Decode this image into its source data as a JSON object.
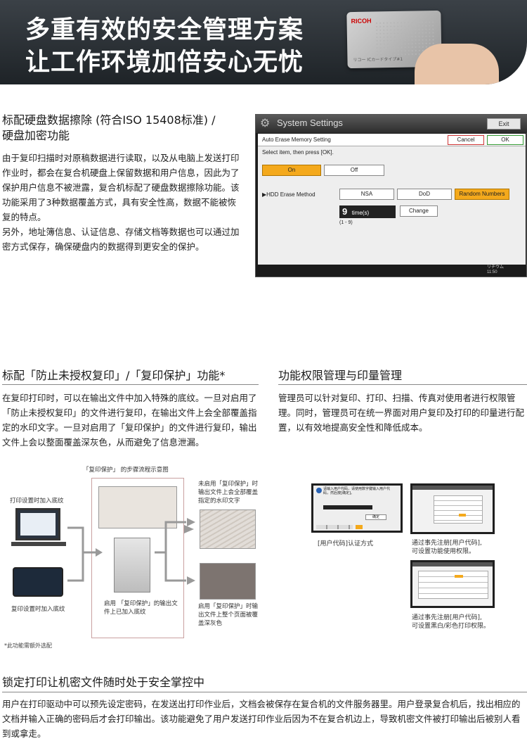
{
  "banner": {
    "line1": "多重有效的安全管理方案",
    "line2": "让工作环境加倍安心无忧",
    "card_brand": "RICOH",
    "card_text": "リコー ICカードタイプ#1"
  },
  "section1": {
    "title_line1": "标配硬盘数据擦除 (符合ISO 15408标准) /",
    "title_line2": "硬盘加密功能",
    "para1": "由于复印扫描时对原稿数据进行读取，以及从电脑上发送打印作业时，都会在复合机硬盘上保留数据和用户信息，因此为了保护用户信息不被泄露，复合机标配了硬盘数据擦除功能。该功能采用了3种数据覆盖方式，具有安全性高，数据不能被恢复的特点。",
    "para2": "另外，地址簿信息、认证信息、存储文档等数据也可以通过加密方式保存，确保硬盘内的数据得到更安全的保护。"
  },
  "panel": {
    "title": "System Settings",
    "exit": "Exit",
    "menu": "Auto Erase Memory Setting",
    "cancel": "Cancel",
    "ok": "OK",
    "instruction": "Select item, then press [OK].",
    "on": "On",
    "off": "Off",
    "method_label": "▶HDD Erase Method",
    "nsa": "NSA",
    "dod": "DoD",
    "random": "Random Numbers",
    "times_value": "9",
    "times_unit": "time(s)",
    "change": "Change",
    "range": "(1 - 9)",
    "status1": "リチウム",
    "status2": "11:50"
  },
  "section2": {
    "title": "标配「防止未授权复印」/「复印保护」功能*",
    "para": "在复印打印时，可以在输出文件中加入特殊的底纹。一旦对启用了「防止未授权复印」的文件进行复印，在输出文件上会全部覆盖指定的水印文字。一旦对启用了「复印保护」的文件进行复印，输出文件上会以整面覆盖深灰色，从而避免了信息泄漏。"
  },
  "section3": {
    "title": "功能权限管理与印量管理",
    "para": "管理员可以针对复印、打印、扫描、传真对使用者进行权限管理。同时，管理员可在统一界面对用户复印及打印的印量进行配置，以有效地提高安全性和降低成本。"
  },
  "diagram": {
    "caption": "「复印保护」 的步骤流程示意图",
    "print_label": "打印设置时加入底纹",
    "copy_label": "复印设置时加入底纹",
    "mid_label": "启用 「复印保护」的输出文件上已加入底纹",
    "top_right": "未启用「复印保护」时输出文件上会全部覆盖指定的水印文字",
    "bottom_right": "启用「复印保护」时输出文件上整个页面被覆盖深灰色",
    "footnote": "*此功能需额外选配"
  },
  "auth": {
    "caption": "[用户代码]认证方式",
    "dialog_text": "请输入用户代码，请使用数字键输入用户代码，然后按[确定]。",
    "ok": "确定",
    "note1_line1": "通过事先注册[用户代码],",
    "note1_line2": "可设置功能使用权限。",
    "note2_line1": "通过事先注册[用户代码],",
    "note2_line2": "可设置黑白/彩色打印权限。"
  },
  "section4": {
    "title": "锁定打印让机密文件随时处于安全掌控中",
    "para": "用户在打印驱动中可以预先设定密码，在发送出打印作业后，文档会被保存在复合机的文件服务器里。用户登录复合机后，找出相应的文档并输入正确的密码后才会打印输出。该功能避免了用户发送打印作业后因为不在复合机边上，导致机密文件被打印输出后被别人看到或拿走。"
  }
}
